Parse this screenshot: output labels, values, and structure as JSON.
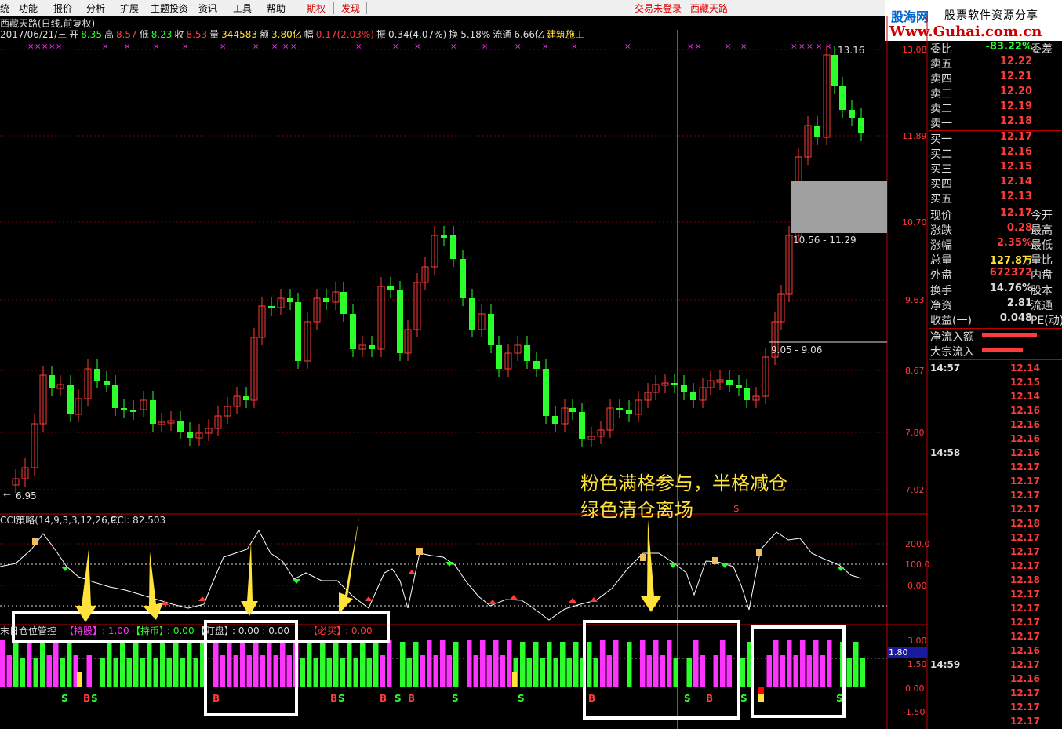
{
  "menu": {
    "items": [
      "统",
      "功能",
      "报价",
      "分析",
      "扩展",
      "主题投资",
      "资讯",
      "工具",
      "帮助"
    ],
    "options_label": "期权",
    "discover_label": "发现",
    "login_status": "交易未登录",
    "broker_label": "西藏天路"
  },
  "watermark": {
    "site_name": "股海网",
    "slogan": "股票软件资源分享",
    "url": "Www.Guhai.com.cn"
  },
  "stock": {
    "title": "西藏天路(日线,前复权)",
    "date": "2017/06/21/三",
    "open_label": "开",
    "open": "8.35",
    "high_label": "高",
    "high": "8.57",
    "low_label": "低",
    "low": "8.23",
    "close_label": "收",
    "close": "8.53",
    "volume_label": "量",
    "volume": "344583",
    "amount_label": "额",
    "amount": "3.80亿",
    "change_label": "幅",
    "change": "0.17(2.03%)",
    "amplitude_label": "振",
    "amplitude": "0.34(4.07%)",
    "turnover_label": "换",
    "turnover": "5.18%",
    "float_label": "流通",
    "float_cap": "6.66亿",
    "sector": "建筑施工"
  },
  "price_axis": [
    "13.08",
    "11.89",
    "10.70",
    "9.63",
    "8.67",
    "7.80",
    "7.02"
  ],
  "price_marks": {
    "high": "13.16",
    "low": "6.95",
    "range_upper": "10.56 - 11.29",
    "range_lower": "9.05 - 9.06",
    "dollar_sign": "$"
  },
  "cci": {
    "title": "CCI策略(14,9,3,3,12,26,9)",
    "value_label": "CCI: 82.503",
    "axis": [
      "200.0",
      "100.0",
      "0.00"
    ]
  },
  "position": {
    "title": "末日仓位管控",
    "hold_label": "【持股】",
    "hold_value": ": 1.00",
    "wait_label": "【持币】",
    "wait_value": ": 0.00",
    "watch_label": "【盯盘】",
    "watch_value": ": 0.00 : 0.00",
    "buy_label": "【必买】",
    "buy_value": ": 0.00",
    "axis": [
      "3.00",
      "1.50",
      "0.00",
      "-1.50"
    ],
    "current_marker": "1.80",
    "signals": [
      {
        "label": "S",
        "color": "green"
      },
      {
        "label": "B",
        "color": "red"
      },
      {
        "label": "S",
        "color": "green"
      },
      {
        "label": "B",
        "color": "red"
      },
      {
        "label": "B",
        "color": "red"
      },
      {
        "label": "S",
        "color": "green"
      },
      {
        "label": "B",
        "color": "red"
      },
      {
        "label": "S",
        "color": "green"
      },
      {
        "label": "B",
        "color": "red"
      },
      {
        "label": "S",
        "color": "green"
      },
      {
        "label": "S",
        "color": "green"
      },
      {
        "label": "B",
        "color": "red"
      },
      {
        "label": "S",
        "color": "green"
      },
      {
        "label": "B",
        "color": "red"
      },
      {
        "label": "S",
        "color": "green"
      },
      {
        "label": "S",
        "color": "green"
      }
    ]
  },
  "annotation": {
    "line1": "粉色满格参与，半格减仓",
    "line2": "绿色清仓离场"
  },
  "quote_panel": {
    "ratio_label": "委比",
    "ratio_value": "-83.22%",
    "ratio_extra": "委差",
    "asks": [
      {
        "label": "卖五",
        "price": "12.22"
      },
      {
        "label": "卖四",
        "price": "12.21"
      },
      {
        "label": "卖三",
        "price": "12.20"
      },
      {
        "label": "卖二",
        "price": "12.19"
      },
      {
        "label": "卖一",
        "price": "12.18"
      }
    ],
    "bids": [
      {
        "label": "买一",
        "price": "12.17"
      },
      {
        "label": "买二",
        "price": "12.16"
      },
      {
        "label": "买三",
        "price": "12.15"
      },
      {
        "label": "买四",
        "price": "12.14"
      },
      {
        "label": "买五",
        "price": "12.13"
      }
    ],
    "stats": [
      {
        "label": "现价",
        "value": "12.17",
        "extra": "今开"
      },
      {
        "label": "涨跌",
        "value": "0.28",
        "extra": "最高"
      },
      {
        "label": "涨幅",
        "value": "2.35%",
        "extra": "最低"
      },
      {
        "label": "总量",
        "value": "127.8万",
        "extra": "量比"
      },
      {
        "label": "外盘",
        "value": "672372",
        "extra": "内盘"
      },
      {
        "label": "换手",
        "value": "14.76%",
        "extra": "股本"
      },
      {
        "label": "净资",
        "value": "2.81",
        "extra": "流通"
      },
      {
        "label": "收益(一)",
        "value": "0.048",
        "extra": "PE(动)"
      }
    ],
    "flows": [
      {
        "label": "净流入额"
      },
      {
        "label": "大宗流入"
      }
    ]
  },
  "ticks": [
    {
      "time": "14:57",
      "value": "12.14"
    },
    {
      "time": "",
      "value": "12.15"
    },
    {
      "time": "",
      "value": "12.14"
    },
    {
      "time": "",
      "value": "12.16"
    },
    {
      "time": "",
      "value": "12.16"
    },
    {
      "time": "",
      "value": "12.16"
    },
    {
      "time": "14:58",
      "value": "12.16"
    },
    {
      "time": "",
      "value": "12.17"
    },
    {
      "time": "",
      "value": "12.17"
    },
    {
      "time": "",
      "value": "12.17"
    },
    {
      "time": "",
      "value": "12.17"
    },
    {
      "time": "",
      "value": "12.18"
    },
    {
      "time": "",
      "value": "12.17"
    },
    {
      "time": "",
      "value": "12.17"
    },
    {
      "time": "",
      "value": "12.17"
    },
    {
      "time": "",
      "value": "12.18"
    },
    {
      "time": "",
      "value": "12.17"
    },
    {
      "time": "",
      "value": "12.17"
    },
    {
      "time": "",
      "value": "12.17"
    },
    {
      "time": "",
      "value": "12.17"
    },
    {
      "time": "",
      "value": "12.16"
    },
    {
      "time": "14:59",
      "value": "12.17"
    },
    {
      "time": "",
      "value": "12.16"
    },
    {
      "time": "",
      "value": "12.17"
    },
    {
      "time": "",
      "value": "12.17"
    },
    {
      "time": "",
      "value": "12.17"
    }
  ],
  "colors": {
    "up": "#ff3b3b",
    "down": "#2bff2b",
    "pink": "#ff33ff",
    "yellow": "#ffe23a",
    "axis_red": "#c00000"
  }
}
